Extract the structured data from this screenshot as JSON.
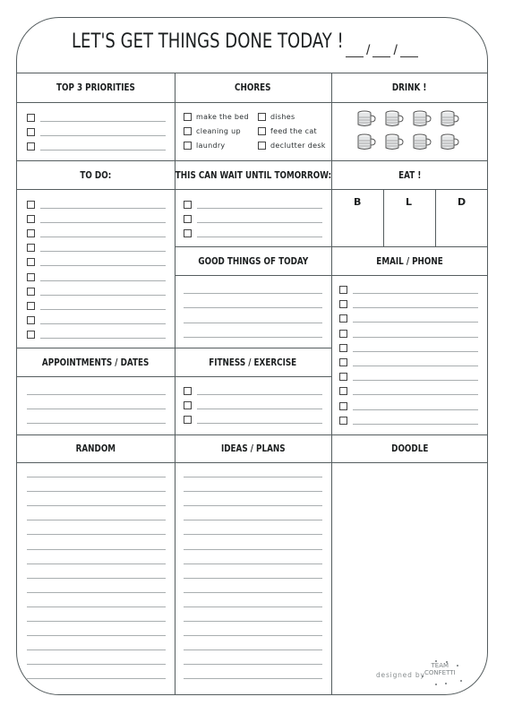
{
  "header": {
    "title": "LET'S GET THINGS DONE TODAY !",
    "date_separator": "/"
  },
  "sections": {
    "priorities": {
      "label": "TOP 3 PRIORITIES",
      "checkbox_lines": 3
    },
    "chores": {
      "label": "CHORES",
      "items": [
        "make the bed",
        "dishes",
        "cleaning up",
        "feed the cat",
        "laundry",
        "declutter desk"
      ]
    },
    "drink": {
      "label": "DRINK !",
      "mugs": 8,
      "icon": "mug-icon"
    },
    "todo": {
      "label": "TO DO:",
      "checkbox_lines": 10
    },
    "wait": {
      "label": "THIS CAN WAIT UNTIL TOMORROW:",
      "checkbox_lines": 3
    },
    "eat": {
      "label": "EAT !",
      "meals": [
        "B",
        "L",
        "D"
      ]
    },
    "good_things": {
      "label": "GOOD THINGS OF TODAY",
      "lines": 4
    },
    "email_phone": {
      "label": "EMAIL / PHONE",
      "checkbox_lines": 10
    },
    "appointments": {
      "label": "APPOINTMENTS / DATES",
      "lines": 3
    },
    "fitness": {
      "label": "FITNESS / EXERCISE",
      "checkbox_lines": 3
    },
    "random": {
      "label": "RANDOM",
      "lines": 15
    },
    "ideas": {
      "label": "IDEAS / PLANS",
      "lines": 15
    },
    "doodle": {
      "label": "DOODLE"
    }
  },
  "footer": {
    "credit": "designed by",
    "logo_line1": "TEAM",
    "logo_line2": "CONFETTI"
  },
  "colors": {
    "border": "#555d5f",
    "text": "#1b1e1f",
    "rule": "#a9aeb0"
  }
}
